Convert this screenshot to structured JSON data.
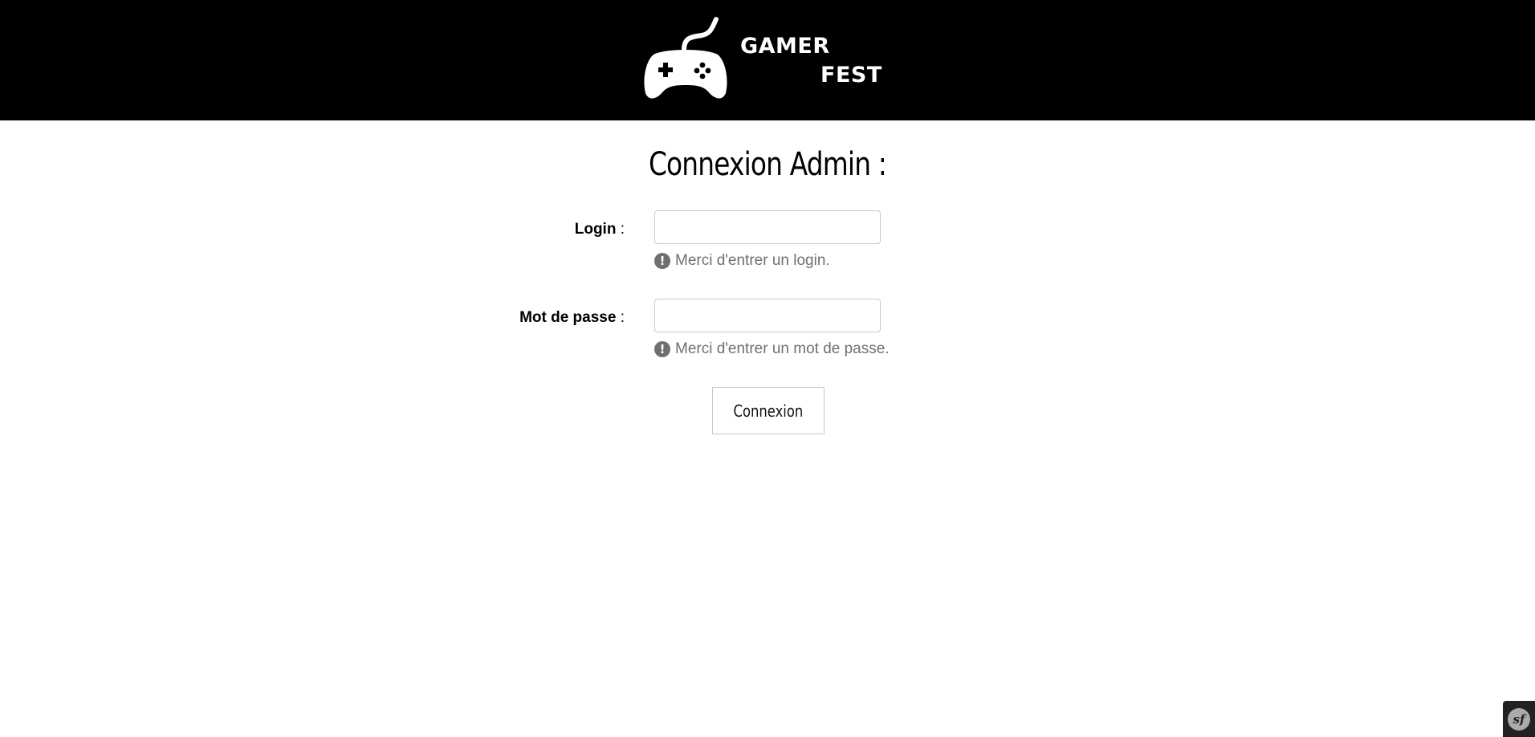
{
  "brand": {
    "line1": "GAMER",
    "line2": "FEST",
    "icon": "gamepad-icon"
  },
  "page": {
    "title": "Connexion Admin :"
  },
  "form": {
    "login": {
      "label": "Login",
      "colon": " :",
      "value": "",
      "hint": "Merci d'entrer un login."
    },
    "password": {
      "label": "Mot de passe",
      "colon": " :",
      "value": "",
      "hint": "Merci d'entrer un mot de passe."
    },
    "submit_label": "Connexion"
  },
  "debug_toolbar": {
    "icon": "symfony-icon",
    "text": "sf"
  },
  "colors": {
    "header_bg": "#000000",
    "hint_text": "#6f6f6f",
    "input_border": "#c8c8c8"
  }
}
